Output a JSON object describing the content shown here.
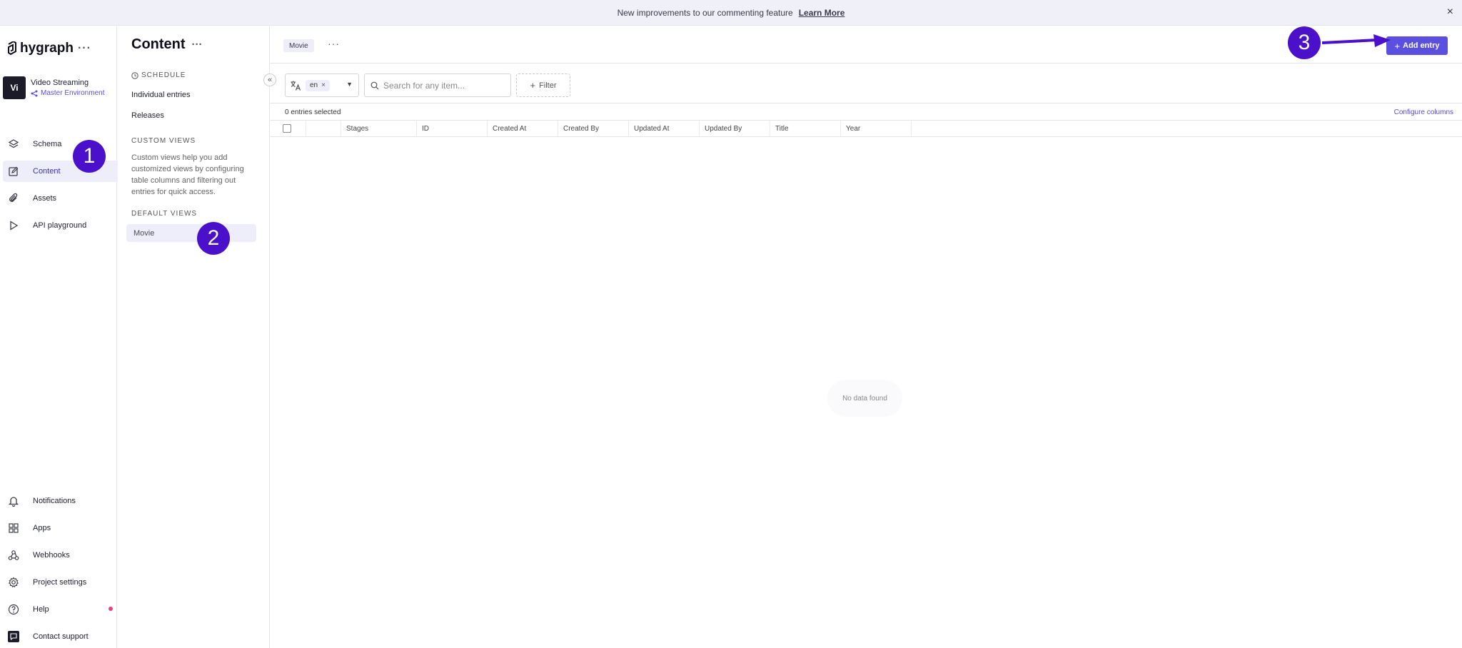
{
  "banner": {
    "message": "New improvements to our commenting feature",
    "link": "Learn More",
    "close": "×"
  },
  "sidebar": {
    "brand": "hygraph",
    "brand_menu": "···",
    "project": {
      "avatar": "Vi",
      "name": "Video Streaming",
      "environment": "Master Environment"
    },
    "top_items": [
      {
        "label": "Schema",
        "icon": "layers-icon"
      },
      {
        "label": "Content",
        "icon": "edit-icon",
        "active": true
      },
      {
        "label": "Assets",
        "icon": "paperclip-icon"
      },
      {
        "label": "API playground",
        "icon": "play-icon"
      }
    ],
    "bottom_items": [
      {
        "label": "Notifications",
        "icon": "bell-icon"
      },
      {
        "label": "Apps",
        "icon": "grid-icon"
      },
      {
        "label": "Webhooks",
        "icon": "webhook-icon"
      },
      {
        "label": "Project settings",
        "icon": "gear-icon"
      },
      {
        "label": "Help",
        "icon": "help-icon"
      },
      {
        "label": "Contact support",
        "icon": "chat-icon"
      }
    ]
  },
  "panel": {
    "title": "Content",
    "title_menu": "···",
    "schedule_label": "SCHEDULE",
    "schedule_items": [
      "Individual entries",
      "Releases"
    ],
    "custom_views_label": "CUSTOM VIEWS",
    "custom_views_desc": "Custom views help you add customized views by configuring table columns and filtering out entries for quick access.",
    "default_views_label": "DEFAULT VIEWS",
    "default_views": [
      "Movie"
    ],
    "collapse": "«"
  },
  "main": {
    "model_tab": "Movie",
    "model_menu": "···",
    "add_entry": "Add entry",
    "add_entry_icon": "+",
    "locale_chip": "en",
    "locale_remove": "×",
    "search_placeholder": "Search for any item...",
    "filter": "Filter",
    "filter_icon": "+",
    "selected_count": "0 entries selected",
    "configure_columns": "Configure columns",
    "columns": [
      "Stages",
      "ID",
      "Created At",
      "Created By",
      "Updated At",
      "Updated By",
      "Title",
      "Year"
    ],
    "empty_text": "No data found"
  },
  "annotations": [
    "1",
    "2",
    "3"
  ],
  "colors": {
    "accent": "#5b4fe0",
    "annotation": "#4b10c9",
    "active_bg": "#eeeefb"
  }
}
